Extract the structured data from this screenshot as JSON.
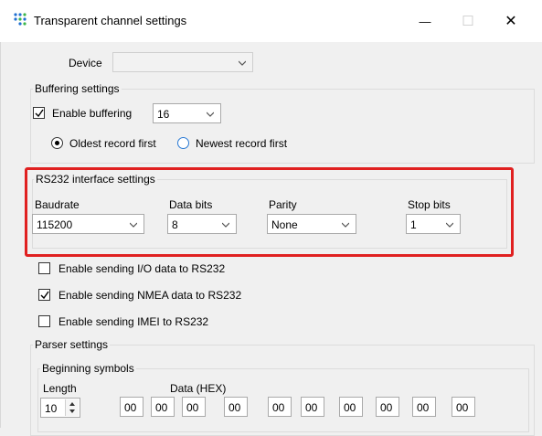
{
  "window": {
    "title": "Transparent channel settings",
    "minimize_glyph": "—",
    "maximize_glyph": "☐",
    "close_glyph": "✕"
  },
  "device": {
    "label": "Device",
    "value": ""
  },
  "buffering": {
    "group_title": "Buffering settings",
    "enable_label": "Enable buffering",
    "enable_checked": true,
    "size_value": "16",
    "oldest_label": "Oldest record first",
    "newest_label": "Newest record first",
    "selected": "oldest"
  },
  "rs232": {
    "group_title": "RS232 interface settings",
    "baudrate_label": "Baudrate",
    "baudrate_value": "115200",
    "databits_label": "Data bits",
    "databits_value": "8",
    "parity_label": "Parity",
    "parity_value": "None",
    "stopbits_label": "Stop bits",
    "stopbits_value": "1",
    "highlight_color": "#e02020"
  },
  "options": {
    "io_label": "Enable sending I/O data to RS232",
    "io_checked": false,
    "nmea_label": "Enable sending NMEA data to RS232",
    "nmea_checked": true,
    "imei_label": "Enable sending IMEI to RS232",
    "imei_checked": false
  },
  "parser": {
    "group_title": "Parser settings",
    "beginning_title": "Beginning symbols",
    "length_label": "Length",
    "length_value": "10",
    "data_label": "Data (HEX)",
    "hex_values": [
      "00",
      "00",
      "00",
      "00",
      "00",
      "00",
      "00",
      "00",
      "00",
      "00"
    ]
  }
}
